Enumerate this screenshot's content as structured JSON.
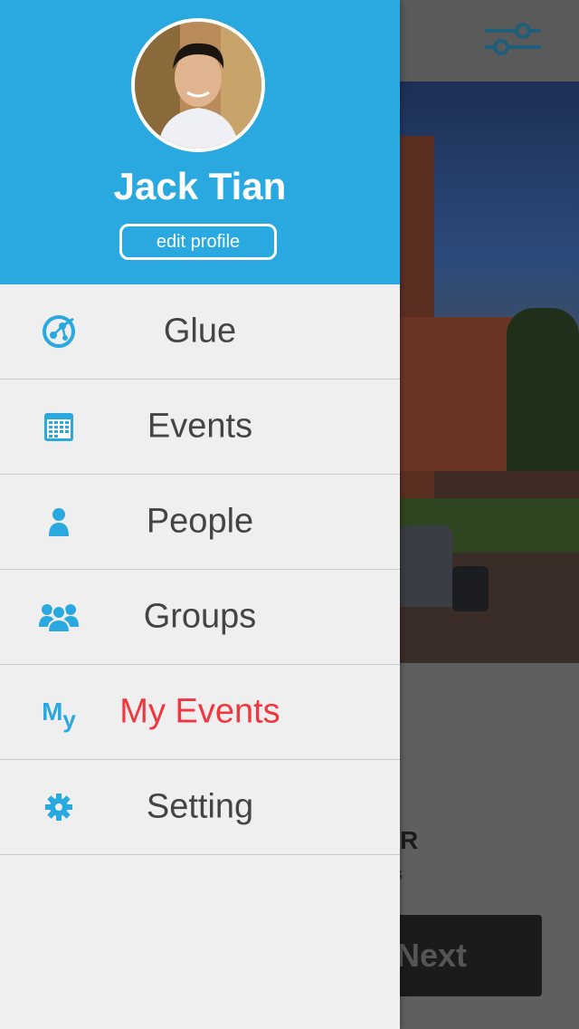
{
  "profile": {
    "name": "Jack Tian",
    "edit_label": "edit profile"
  },
  "menu": {
    "items": [
      {
        "label": "Glue",
        "icon": "glue-icon"
      },
      {
        "label": "Events",
        "icon": "calendar-icon"
      },
      {
        "label": "People",
        "icon": "person-icon"
      },
      {
        "label": "Groups",
        "icon": "group-icon"
      },
      {
        "label": "My Events",
        "icon": "my-icon",
        "active": true
      },
      {
        "label": "Setting",
        "icon": "gear-icon"
      }
    ],
    "my_icon_text_m": "M",
    "my_icon_text_y": "y"
  },
  "background": {
    "partial_heading": "R",
    "partial_sub": "s",
    "next_label": "Next"
  },
  "colors": {
    "accent": "#2aa8e0",
    "active": "#f0373f",
    "menu_bg": "#efefef",
    "text": "#444444"
  }
}
